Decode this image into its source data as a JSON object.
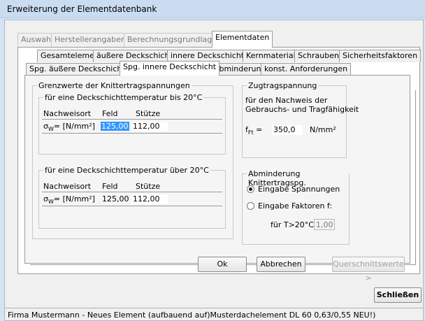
{
  "window": {
    "title": "Erweiterung der Elementdatenbank"
  },
  "main_tabs": [
    {
      "label": "Auswahl"
    },
    {
      "label": "Herstellerangaben"
    },
    {
      "label": "Berechnungsgrundlage"
    },
    {
      "label": "Elementdaten"
    }
  ],
  "sub_tabs_row1": [
    {
      "label": "Gesamtelement"
    },
    {
      "label": "äußere Deckschicht"
    },
    {
      "label": "innere Deckschicht"
    },
    {
      "label": "Kernmaterial"
    },
    {
      "label": "Schrauben"
    },
    {
      "label": "Sicherheitsfaktoren"
    }
  ],
  "sub_tabs_row2": [
    {
      "label": "Spg. äußere Deckschicht"
    },
    {
      "label": "Spg. innere Deckschicht"
    },
    {
      "label": "Abminderung"
    },
    {
      "label": "konst. Anforderungen"
    }
  ],
  "grenzwerte": {
    "title": "Grenzwerte der Knittertragspannungen",
    "upto20": {
      "title": "für eine Deckschichttemperatur bis 20°C",
      "col_nachweisort": "Nachweisort",
      "col_feld": "Feld",
      "col_stuetze": "Stütze",
      "sigma_sym": "σ",
      "sigma_sub": "W",
      "sigma_unit": "=  [N/mm²]",
      "feld": "125,00",
      "stuetze": "112,00"
    },
    "over20": {
      "title": "für eine Deckschichttemperatur über 20°C",
      "col_nachweisort": "Nachweisort",
      "col_feld": "Feld",
      "col_stuetze": "Stütze",
      "sigma_sym": "σ",
      "sigma_sub": "W",
      "sigma_unit": "=  [N/mm²]",
      "feld": "125,00",
      "stuetze": "112,00"
    }
  },
  "zugtrag": {
    "title": "Zugtragspannung",
    "line1": "für den Nachweis der",
    "line2": "Gebrauchs- und Tragfähigkeit",
    "f_sym": "f",
    "f_sub": "Ft",
    "f_eq": " =",
    "f_value": "350,0",
    "f_unit": "N/mm²"
  },
  "abminderung": {
    "title": "Abminderung Knittertragspg.",
    "radio_spannungen": "Eingabe Spannungen",
    "radio_faktoren": "Eingabe Faktoren f:",
    "faktor_label": "für T>20°C",
    "faktor_value": "1,00"
  },
  "buttons": {
    "ok": "Ok",
    "abbrechen": "Abbrechen",
    "querschnitt": "Querschnittswerte >",
    "schliessen": "Schließen"
  },
  "status_text": "Firma Mustermann - Neues Element  (aufbauend auf)Musterdachelement DL 60 0,63/0,55 NEU!)"
}
